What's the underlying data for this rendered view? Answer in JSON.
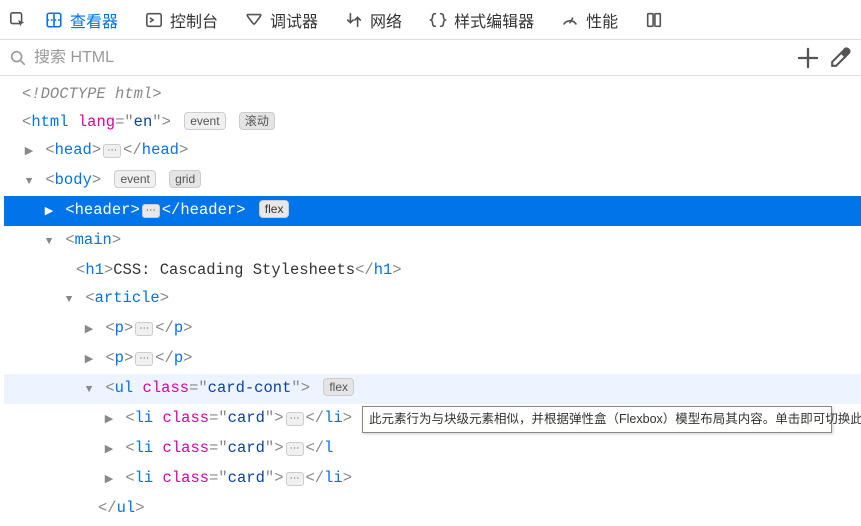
{
  "toolbar": {
    "tabs": [
      {
        "name": "inspector",
        "label": "查看器",
        "active": true
      },
      {
        "name": "console",
        "label": "控制台"
      },
      {
        "name": "debugger",
        "label": "调试器"
      },
      {
        "name": "network",
        "label": "网络"
      },
      {
        "name": "styleeditor",
        "label": "样式编辑器"
      },
      {
        "name": "performance",
        "label": "性能"
      }
    ]
  },
  "search": {
    "placeholder": "搜索 HTML"
  },
  "badges": {
    "event": "event",
    "scroll": "滚动",
    "grid": "grid",
    "flex": "flex"
  },
  "tree": {
    "doctype": "<!DOCTYPE html>",
    "html": {
      "tag": "html",
      "attrs": [
        {
          "n": "lang",
          "v": "en"
        }
      ]
    },
    "head": {
      "tag": "head"
    },
    "body": {
      "tag": "body"
    },
    "header": {
      "tag": "header"
    },
    "main": {
      "tag": "main"
    },
    "h1": {
      "tag": "h1",
      "text": "CSS: Cascading Stylesheets"
    },
    "article": {
      "tag": "article"
    },
    "p": {
      "tag": "p"
    },
    "ul": {
      "tag": "ul",
      "attrs": [
        {
          "n": "class",
          "v": "card-cont"
        }
      ]
    },
    "li": {
      "tag": "li",
      "attrs": [
        {
          "n": "class",
          "v": "card"
        }
      ]
    }
  },
  "tooltip": "此元素行为与块级元素相似，并根据弹性盒（Flexbox）模型布局其内容。单击即可切换此元素的弹性盒叠加层。"
}
